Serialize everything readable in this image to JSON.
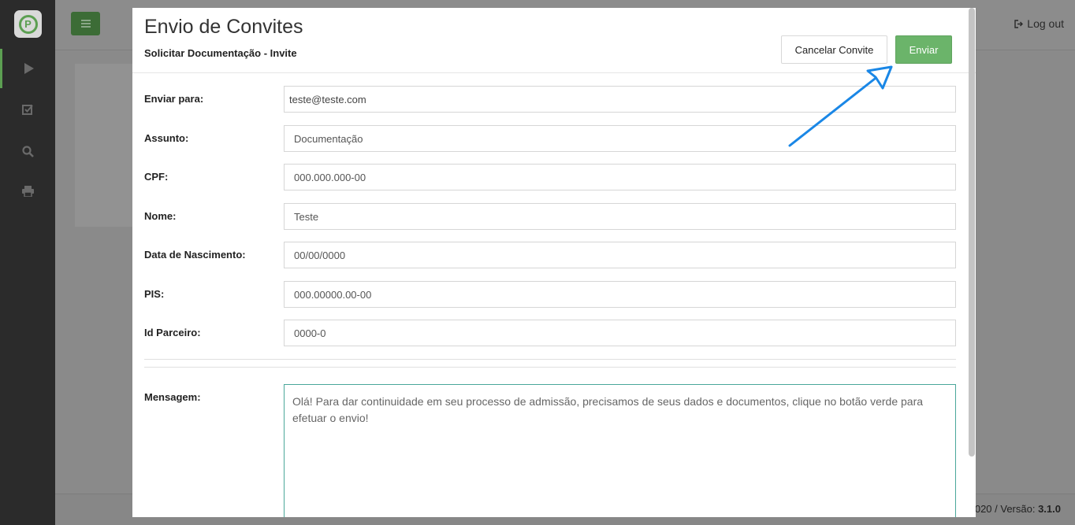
{
  "logo": {
    "letter": "P"
  },
  "sidebar": {
    "items": [
      {
        "icon": "play-icon"
      },
      {
        "icon": "checkbox-icon"
      },
      {
        "icon": "search-icon"
      },
      {
        "icon": "print-icon"
      }
    ]
  },
  "topbar": {
    "logout_label": "Log out"
  },
  "footer": {
    "version_prefix": "020 / Versão: ",
    "version": "3.1.0"
  },
  "modal": {
    "title": "Envio de Convites",
    "subtitle": "Solicitar Documentação - Invite",
    "cancel_label": "Cancelar Convite",
    "send_label": "Enviar",
    "fields": [
      {
        "label": "Enviar para:",
        "value": "teste@teste.com"
      },
      {
        "label": "Assunto:",
        "value": "Documentação"
      },
      {
        "label": "CPF:",
        "value": "000.000.000-00"
      },
      {
        "label": "Nome:",
        "value": "Teste"
      },
      {
        "label": "Data de Nascimento:",
        "value": "00/00/0000"
      },
      {
        "label": "PIS:",
        "value": "000.00000.00-00"
      },
      {
        "label": "Id Parceiro:",
        "value": "0000-0"
      }
    ],
    "message_label": "Mensagem:",
    "message_text": "Olá! Para dar continuidade em seu processo de admissão, precisamos de seus dados e documentos, clique no botão verde para efetuar o envio!"
  },
  "colors": {
    "accent": "#6bb46a",
    "arrow": "#1a87e6",
    "sidebar": "#2b2b2b"
  }
}
